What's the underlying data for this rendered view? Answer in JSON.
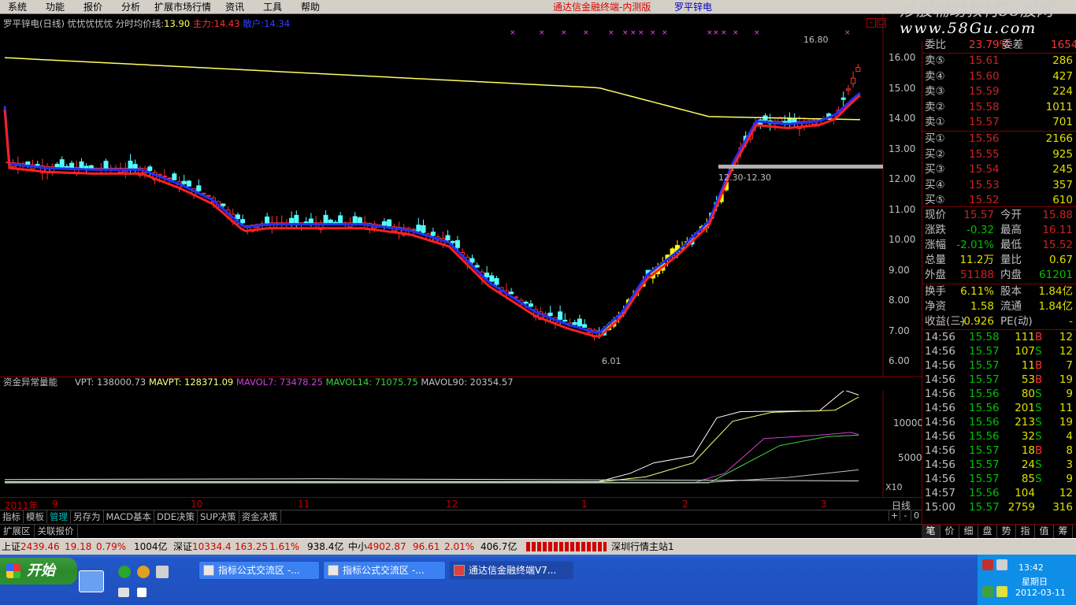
{
  "menu": [
    "系统",
    "功能",
    "报价",
    "分析",
    "扩展市场行情",
    "资讯",
    "工具",
    "帮助"
  ],
  "app_title": "通达信金融终端-内测版",
  "stock_title": "罗平锌电",
  "watermark": {
    "line1": "炒股辅助教材58股网",
    "line2": "www.58Gu.com"
  },
  "main_legend": {
    "name": "罗平锌电(日线)",
    "tags": "忧忧忧忧忧",
    "avg_label": "分时均价线:",
    "avg_value": "13.90",
    "zhuli_label": "主力:",
    "zhuli_value": "14.43",
    "sanhu_label": "散户:",
    "sanhu_value": "14.34"
  },
  "price_axis": [
    "16.00",
    "15.00",
    "14.00",
    "13.00",
    "12.00",
    "11.00",
    "10.00",
    "9.00",
    "8.00",
    "7.00",
    "6.00"
  ],
  "annotations": {
    "high": "16.80",
    "low": "6.01",
    "range": "12.30-12.30"
  },
  "indicator_legend": {
    "name": "资金异常量能",
    "vpt": "VPT: 138000.73",
    "mavpt": "MAVPT: 128371.09",
    "mavol7": "MAVOL7: 73478.25",
    "mavol14": "MAVOL14: 71075.75",
    "mavol90": "MAVOL90: 20354.57"
  },
  "volume_axis": [
    "10000",
    "5000",
    "X10"
  ],
  "date_axis": [
    "2011年",
    "9",
    "10",
    "11",
    "12",
    "1",
    "2",
    "3"
  ],
  "period": "日线",
  "tabs": [
    "指标",
    "模板",
    "管理",
    "另存为",
    "MACD基本",
    "DDE决策",
    "SUP决策",
    "资金决策"
  ],
  "zoom_controls": [
    "+",
    "-",
    "0"
  ],
  "ext_tabs": [
    "扩展区",
    "关联报价"
  ],
  "quote_header": {
    "label1": "委比",
    "value1": "23.79%",
    "label2": "委差",
    "value2": "1654"
  },
  "asks": [
    {
      "label": "卖⑤",
      "price": "15.61",
      "vol": "286"
    },
    {
      "label": "卖④",
      "price": "15.60",
      "vol": "427"
    },
    {
      "label": "卖③",
      "price": "15.59",
      "vol": "224"
    },
    {
      "label": "卖②",
      "price": "15.58",
      "vol": "1011"
    },
    {
      "label": "卖①",
      "price": "15.57",
      "vol": "701"
    }
  ],
  "bids": [
    {
      "label": "买①",
      "price": "15.56",
      "vol": "2166"
    },
    {
      "label": "买②",
      "price": "15.55",
      "vol": "925"
    },
    {
      "label": "买③",
      "price": "15.54",
      "vol": "245"
    },
    {
      "label": "买④",
      "price": "15.53",
      "vol": "357"
    },
    {
      "label": "买⑤",
      "price": "15.52",
      "vol": "610"
    }
  ],
  "stats": [
    {
      "l1": "现价",
      "v1": "15.57",
      "l2": "今开",
      "v2": "15.88"
    },
    {
      "l1": "涨跌",
      "v1": "-0.32",
      "l2": "最高",
      "v2": "16.11"
    },
    {
      "l1": "涨幅",
      "v1": "-2.01%",
      "l2": "最低",
      "v2": "15.52"
    },
    {
      "l1": "总量",
      "v1": "11.2万",
      "l2": "量比",
      "v2": "0.67"
    },
    {
      "l1": "外盘",
      "v1": "51188",
      "l2": "内盘",
      "v2": "61201"
    }
  ],
  "stats2": [
    {
      "l1": "换手",
      "v1": "6.11%",
      "l2": "股本",
      "v2": "1.84亿"
    },
    {
      "l1": "净资",
      "v1": "1.58",
      "l2": "流通",
      "v2": "1.84亿"
    },
    {
      "l1": "收益(三)",
      "v1": "-0.926",
      "l2": "PE(动)",
      "v2": "-"
    }
  ],
  "ticks": [
    {
      "t": "14:56",
      "p": "15.58",
      "v": "111",
      "d": "B",
      "n": "12"
    },
    {
      "t": "14:56",
      "p": "15.57",
      "v": "107",
      "d": "S",
      "n": "12"
    },
    {
      "t": "14:56",
      "p": "15.57",
      "v": "11",
      "d": "B",
      "n": "7"
    },
    {
      "t": "14:56",
      "p": "15.57",
      "v": "53",
      "d": "B",
      "n": "19"
    },
    {
      "t": "14:56",
      "p": "15.56",
      "v": "80",
      "d": "S",
      "n": "9"
    },
    {
      "t": "14:56",
      "p": "15.56",
      "v": "201",
      "d": "S",
      "n": "11"
    },
    {
      "t": "14:56",
      "p": "15.56",
      "v": "213",
      "d": "S",
      "n": "19"
    },
    {
      "t": "14:56",
      "p": "15.56",
      "v": "32",
      "d": "S",
      "n": "4"
    },
    {
      "t": "14:56",
      "p": "15.57",
      "v": "18",
      "d": "B",
      "n": "8"
    },
    {
      "t": "14:56",
      "p": "15.57",
      "v": "24",
      "d": "S",
      "n": "3"
    },
    {
      "t": "14:56",
      "p": "15.57",
      "v": "85",
      "d": "S",
      "n": "9"
    },
    {
      "t": "14:57",
      "p": "15.56",
      "v": "104",
      "d": "",
      "n": "12"
    },
    {
      "t": "15:00",
      "p": "15.57",
      "v": "2759",
      "d": "",
      "n": "316"
    }
  ],
  "right_tabs": [
    "笔",
    "价",
    "细",
    "盘",
    "势",
    "指",
    "值",
    "筹"
  ],
  "status": {
    "sh_label": "上证",
    "sh_val": "2439.46",
    "sh_chg": "19.18",
    "sh_pct": "0.79%",
    "sh_amt": "1004亿",
    "sz_label": "深证",
    "sz_val": "10334.4",
    "sz_chg": "163.25",
    "sz_pct": "1.61%",
    "sz_amt": "938.4亿",
    "zx_label": "中小",
    "zx_val": "4902.87",
    "zx_chg": "96.61",
    "zx_pct": "2.01%",
    "zx_amt": "406.7亿",
    "server": "深圳行情主站1"
  },
  "taskbar": {
    "start": "开始",
    "tasks": [
      "指标公式交流区 -...",
      "指标公式交流区 -...",
      "通达信金融终端V7..."
    ],
    "time": "13:42",
    "day": "星期日",
    "date": "2012-03-11"
  },
  "colors": {
    "up": "#ff3232",
    "down": "#54ffff",
    "zhuli": "#ff2020",
    "sanhu": "#2030ff",
    "avg": "#ffff60",
    "accent": "#c00000"
  }
}
